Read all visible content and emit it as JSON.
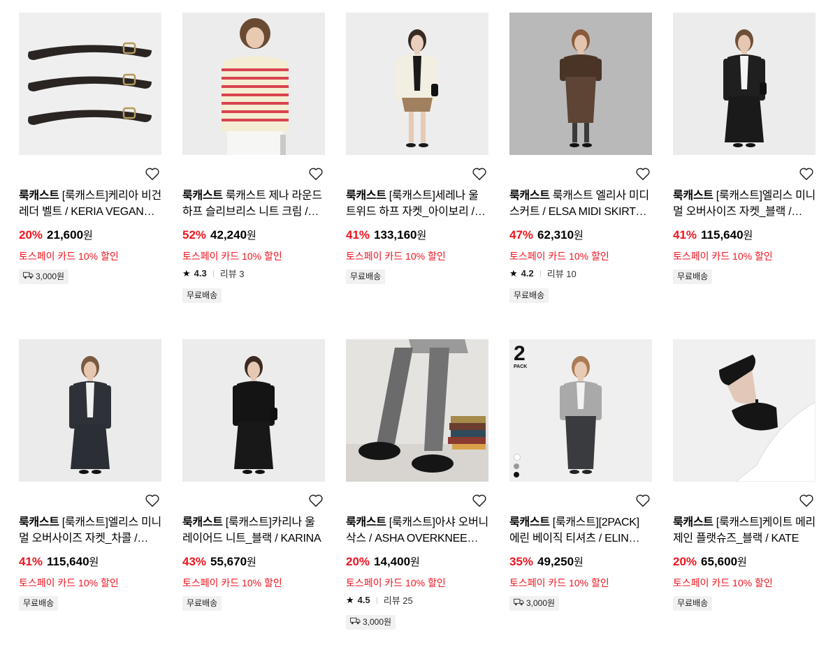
{
  "currency_unit": "원",
  "products": [
    {
      "brand": "룩캐스트",
      "name": "[룩캐스트]케리아 비건 레더 벨트 / KERIA VEGAN LEATHER BELT",
      "discount": "20%",
      "price": "21,600",
      "promo": "토스페이 카드 10% 할인",
      "rating": null,
      "review": null,
      "badge": "3,000원",
      "badge_icon": "truck-icon",
      "image": "belts"
    },
    {
      "brand": "룩캐스트",
      "name": "룩캐스트 제나 라운드 하프 슬리브리스 니트 크림 / ZENA",
      "discount": "52%",
      "price": "42,240",
      "promo": "토스페이 카드 10% 할인",
      "rating": "4.3",
      "review": "리뷰 3",
      "badge": "무료배송",
      "badge_icon": null,
      "image": "stripe"
    },
    {
      "brand": "룩캐스트",
      "name": "[룩캐스트]세레나 울 트위드 하프 자켓_아이보리 / SERENA",
      "discount": "41%",
      "price": "133,160",
      "promo": "토스페이 카드 10% 할인",
      "rating": null,
      "review": null,
      "badge": "무료배송",
      "badge_icon": null,
      "image": "ivoryjacket"
    },
    {
      "brand": "룩캐스트",
      "name": "룩캐스트 엘리사 미디 스커트 / ELSA MIDI SKIRT BROWN",
      "discount": "47%",
      "price": "62,310",
      "promo": "토스페이 카드 10% 할인",
      "rating": "4.2",
      "review": "리뷰 10",
      "badge": "무료배송",
      "badge_icon": null,
      "image": "brownskirt"
    },
    {
      "brand": "룩캐스트",
      "name": "[룩캐스트]엘리스 미니멀 오버사이즈 자켓_블랙 / ELLIS",
      "discount": "41%",
      "price": "115,640",
      "promo": "토스페이 카드 10% 할인",
      "rating": null,
      "review": null,
      "badge": "무료배송",
      "badge_icon": null,
      "image": "blacksuit"
    },
    {
      "brand": "룩캐스트",
      "name": "[룩캐스트]엘리스 미니멀 오버사이즈 자켓_차콜 / ELLIS",
      "discount": "41%",
      "price": "115,640",
      "promo": "토스페이 카드 10% 할인",
      "rating": null,
      "review": null,
      "badge": "무료배송",
      "badge_icon": null,
      "image": "charcoalsuit"
    },
    {
      "brand": "룩캐스트",
      "name": "[룩캐스트]카리나 울 레이어드 니트_블랙 / KARINA",
      "discount": "43%",
      "price": "55,670",
      "promo": "토스페이 카드 10% 할인",
      "rating": null,
      "review": null,
      "badge": "무료배송",
      "badge_icon": null,
      "image": "blackknit"
    },
    {
      "brand": "룩캐스트",
      "name": "[룩캐스트]아샤 오버니삭스 / ASHA OVERKNEE SOCKS",
      "discount": "20%",
      "price": "14,400",
      "promo": "토스페이 카드 10% 할인",
      "rating": "4.5",
      "review": "리뷰 25",
      "badge": "3,000원",
      "badge_icon": "truck-icon",
      "image": "socks"
    },
    {
      "brand": "룩캐스트",
      "name": "[룩캐스트][2PACK] 에린 베이직 티셔츠 / ELIN BASIC",
      "discount": "35%",
      "price": "49,250",
      "promo": "토스페이 카드 10% 할인",
      "rating": null,
      "review": null,
      "badge": "3,000원",
      "badge_icon": "truck-icon",
      "image": "greyknit",
      "overlay_text": "2",
      "overlay_sub": "PACK"
    },
    {
      "brand": "룩캐스트",
      "name": "[룩캐스트]케이트 메리제인 플랫슈즈_블랙 / KATE",
      "discount": "20%",
      "price": "65,600",
      "promo": "토스페이 카드 10% 할인",
      "rating": null,
      "review": null,
      "badge": "무료배송",
      "badge_icon": null,
      "image": "shoes"
    }
  ],
  "colors": {
    "discount": "#f0141e",
    "badge_bg": "#f1f1f1"
  },
  "icons": {
    "wishlist": "heart-outline-icon",
    "rating": "star-icon",
    "shipping": "truck-icon"
  }
}
